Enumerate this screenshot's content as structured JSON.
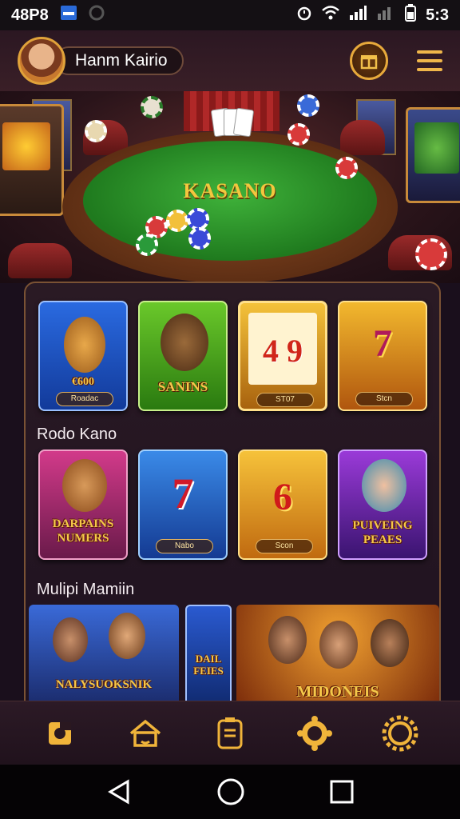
{
  "status_bar": {
    "left_text": "48P8",
    "time": "5:3"
  },
  "header": {
    "user_name": "Hanm Kairio"
  },
  "hero": {
    "table_logo": "KASANO"
  },
  "games": {
    "row1": [
      {
        "title": "€600",
        "button": "Roadac",
        "colors": [
          "#2a6ae0",
          "#123a9a"
        ]
      },
      {
        "title": "SANINS",
        "button": "",
        "colors": [
          "#6ac82a",
          "#2a7a10"
        ]
      },
      {
        "title": "4 9",
        "button": "ST07",
        "colors": [
          "#f4c23a",
          "#a8620e"
        ]
      },
      {
        "title": "7",
        "button": "Stcn",
        "colors": [
          "#f2b82e",
          "#b0560e"
        ]
      }
    ],
    "section2_title": "Rodo Kano",
    "row2": [
      {
        "title": "DARPAINS NUMERS",
        "button": "",
        "colors": [
          "#d23a8a",
          "#6a1a4a"
        ]
      },
      {
        "title": "7",
        "button": "Nabo",
        "colors": [
          "#3a8ae8",
          "#143a92"
        ]
      },
      {
        "title": "6",
        "button": "Scon",
        "colors": [
          "#f6c23a",
          "#c06a10"
        ]
      },
      {
        "title": "PUIVEING PEAES",
        "button": "",
        "colors": [
          "#9a3ad8",
          "#3a1470"
        ]
      }
    ],
    "section3_title": "Mulipi Mamiin",
    "row3": [
      {
        "title": "NALYSUOKSNIK",
        "colors": [
          "#3a6ad8",
          "#1a2a6a"
        ]
      },
      {
        "title": "DAIL FEIES",
        "colors": [
          "#2a5ad0",
          "#102a70"
        ]
      },
      {
        "title": "MIDONEIS",
        "colors": [
          "#e87a1a",
          "#7a2a0a"
        ]
      }
    ]
  },
  "bottom_nav": {
    "items": [
      "crop-icon",
      "home-icon",
      "wallet-icon",
      "chat-icon",
      "settings-icon"
    ],
    "accent": "#f0b43a"
  },
  "system_nav": {
    "items": [
      "back-icon",
      "home-circle-icon",
      "recents-icon"
    ]
  }
}
